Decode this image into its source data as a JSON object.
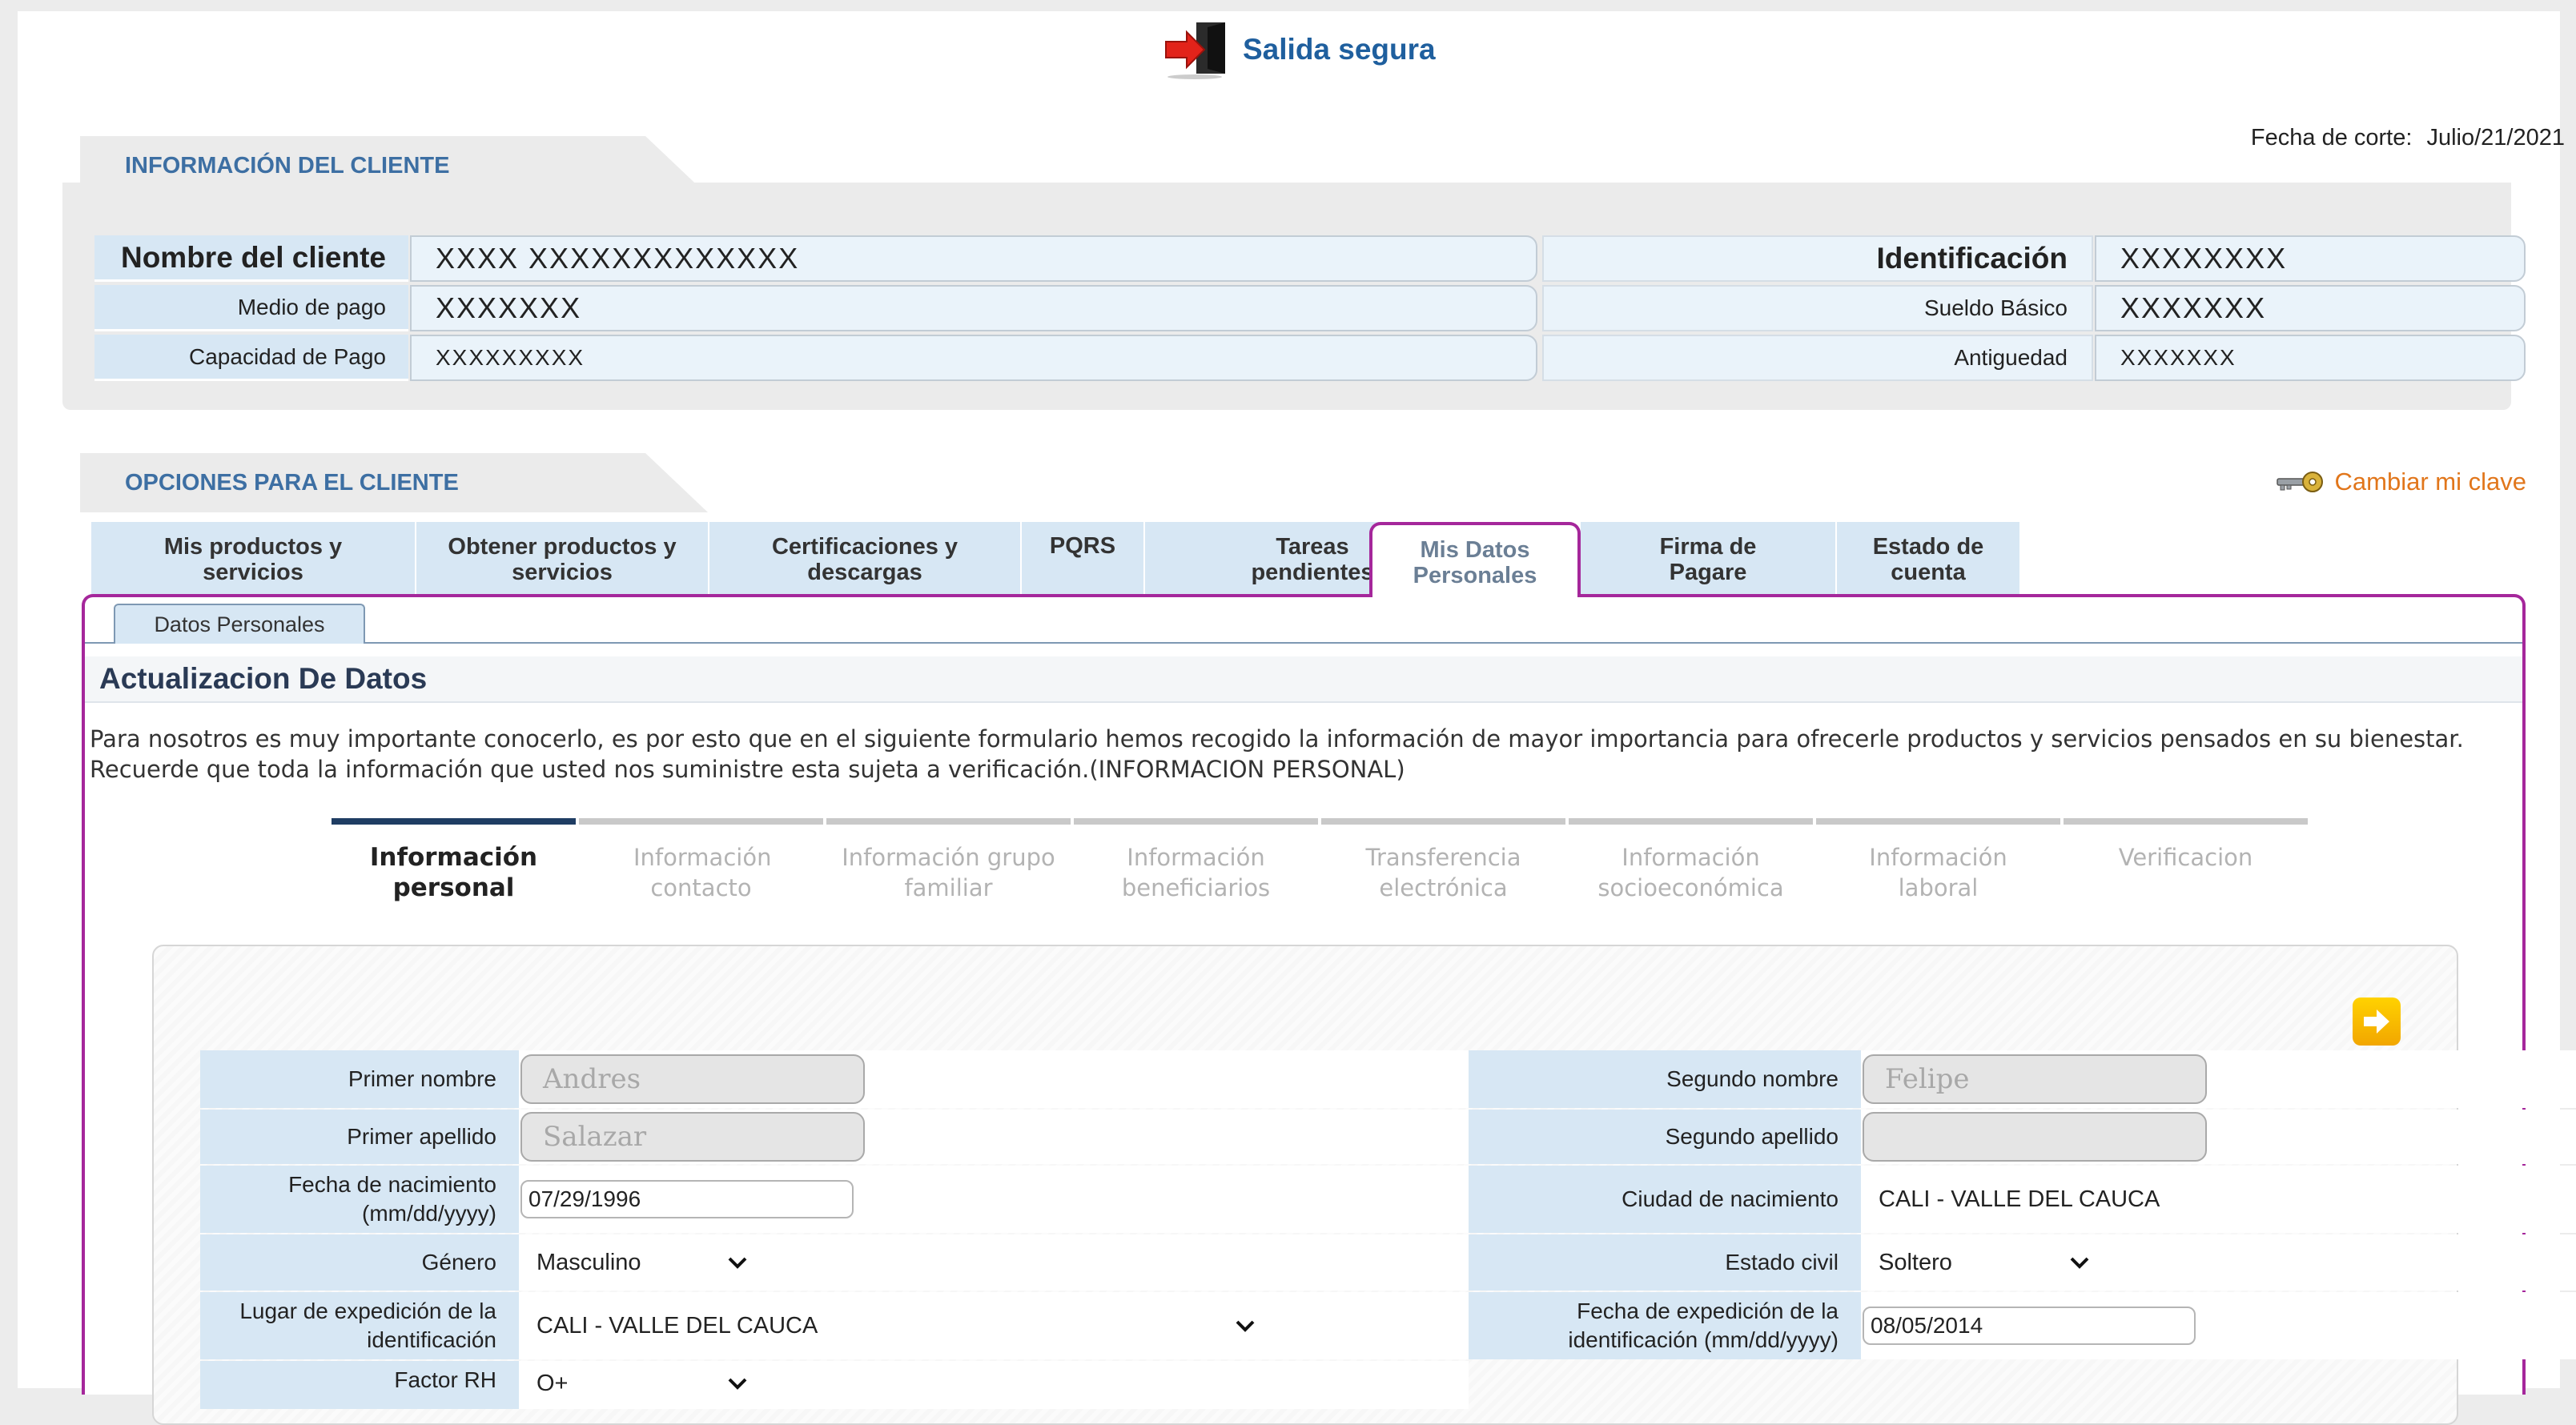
{
  "header": {
    "exit_label": "Salida segura"
  },
  "client_section": {
    "title": "INFORMACIÓN DEL CLIENTE",
    "cutoff_label": "Fecha de corte:",
    "cutoff_value": "Julio/21/2021",
    "rows": [
      {
        "label": "Nombre del cliente",
        "value": "XXXX XXXXXXXXXXXXX",
        "right_label": "Identificación",
        "right_value": "XXXXXXXX"
      },
      {
        "label": "Medio de pago",
        "value": "XXXXXXX",
        "right_label": "Sueldo Básico",
        "right_value": "XXXXXXX"
      },
      {
        "label": "Capacidad de Pago",
        "value": "XXXXXXXXX",
        "right_label": "Antiguedad",
        "right_value": "XXXXXXX"
      }
    ]
  },
  "options_section": {
    "title": "OPCIONES PARA EL CLIENTE",
    "change_password": "Cambiar mi clave",
    "tabs": [
      {
        "label": "Mis productos y servicios"
      },
      {
        "label": "Obtener productos y servicios"
      },
      {
        "label": "Certificaciones y descargas"
      },
      {
        "label": "PQRS"
      },
      {
        "label": "Tareas pendientes"
      },
      {
        "label": "Mis Datos Personales",
        "active": true
      },
      {
        "label": "Firma de Pagare"
      },
      {
        "label": "Estado de cuenta"
      }
    ],
    "subtab": "Datos Personales"
  },
  "main": {
    "title": "Actualizacion De Datos",
    "intro": "Para nosotros es muy importante conocerlo, es por esto que en el siguiente formulario hemos recogido la información de mayor importancia para ofrecerle productos y servicios pensados en su bienestar. Recuerde que toda la información que usted nos suministre esta sujeta a verificación.(INFORMACION PERSONAL)",
    "steps": [
      {
        "label": "Información personal",
        "active": true
      },
      {
        "label": "Información contacto"
      },
      {
        "label": "Información grupo familiar"
      },
      {
        "label": "Información beneficiarios"
      },
      {
        "label": "Transferencia electrónica"
      },
      {
        "label": "Información socioeconómica"
      },
      {
        "label": "Información laboral"
      },
      {
        "label": "Verificacion"
      }
    ]
  },
  "form": {
    "primer_nombre": {
      "label": "Primer nombre",
      "value": "Andres"
    },
    "segundo_nombre": {
      "label": "Segundo nombre",
      "value": "Felipe"
    },
    "primer_apellido": {
      "label": "Primer apellido",
      "value": "Salazar"
    },
    "segundo_apellido": {
      "label": "Segundo apellido",
      "value": ""
    },
    "fecha_nacimiento": {
      "label": "Fecha de nacimiento (mm/dd/yyyy)",
      "value": "07/29/1996"
    },
    "ciudad_nacimiento": {
      "label": "Ciudad de nacimiento",
      "value": "CALI - VALLE DEL CAUCA"
    },
    "genero": {
      "label": "Género",
      "value": "Masculino"
    },
    "estado_civil": {
      "label": "Estado civil",
      "value": "Soltero"
    },
    "lugar_expedicion": {
      "label": "Lugar de expedición de la identificación",
      "value": "CALI - VALLE DEL CAUCA"
    },
    "fecha_expedicion": {
      "label": "Fecha de expedición de la identificación (mm/dd/yyyy)",
      "value": "08/05/2014"
    },
    "factor_rh": {
      "label": "Factor RH",
      "value": "O+"
    }
  },
  "colors": {
    "accent_tab_border": "#a5279b",
    "label_bg": "#d7e7f4",
    "link_blue": "#1f5f9e",
    "orange": "#e1761b"
  },
  "icons": [
    "exit-door-icon",
    "key-icon",
    "next-arrow-icon",
    "chevron-down-icon"
  ]
}
